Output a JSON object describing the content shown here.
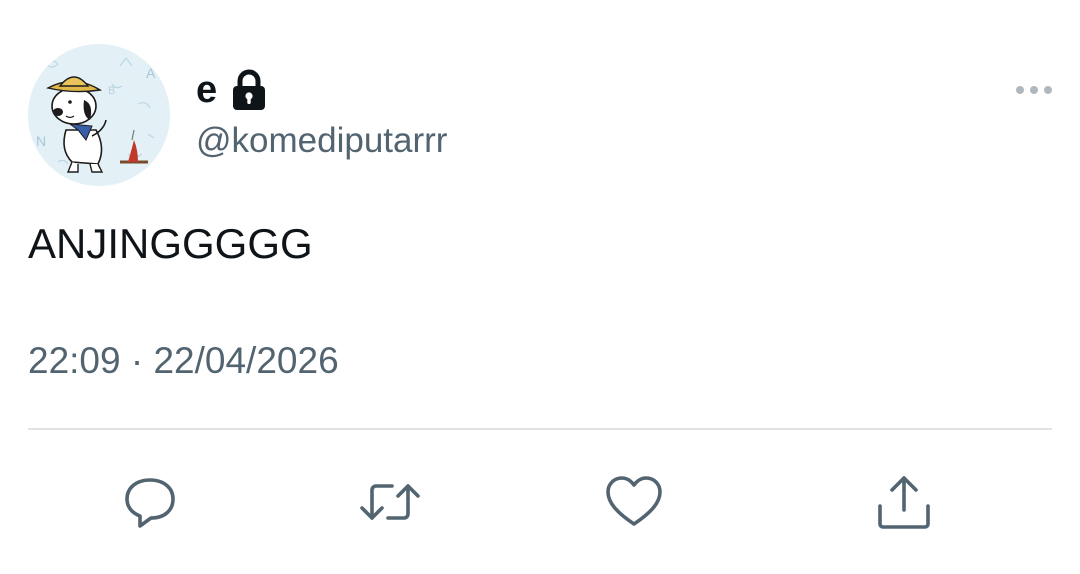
{
  "tweet": {
    "author": {
      "display_name": "e",
      "handle": "@komediputarrr",
      "protected_icon": "lock-icon",
      "avatar_icon": "snoopy-scout-avatar"
    },
    "text": "ANJINGGGGG",
    "timestamp": "22:09 · 22/04/2026",
    "more_icon": "more-horizontal-icon",
    "actions": [
      {
        "name": "reply",
        "icon": "reply-icon"
      },
      {
        "name": "retweet",
        "icon": "retweet-icon"
      },
      {
        "name": "like",
        "icon": "heart-icon"
      },
      {
        "name": "share",
        "icon": "share-icon"
      }
    ],
    "colors": {
      "primary_text": "#0f1419",
      "secondary_text": "#536471",
      "divider": "#dfe3e6",
      "avatar_background": "#e3f1f7"
    }
  }
}
